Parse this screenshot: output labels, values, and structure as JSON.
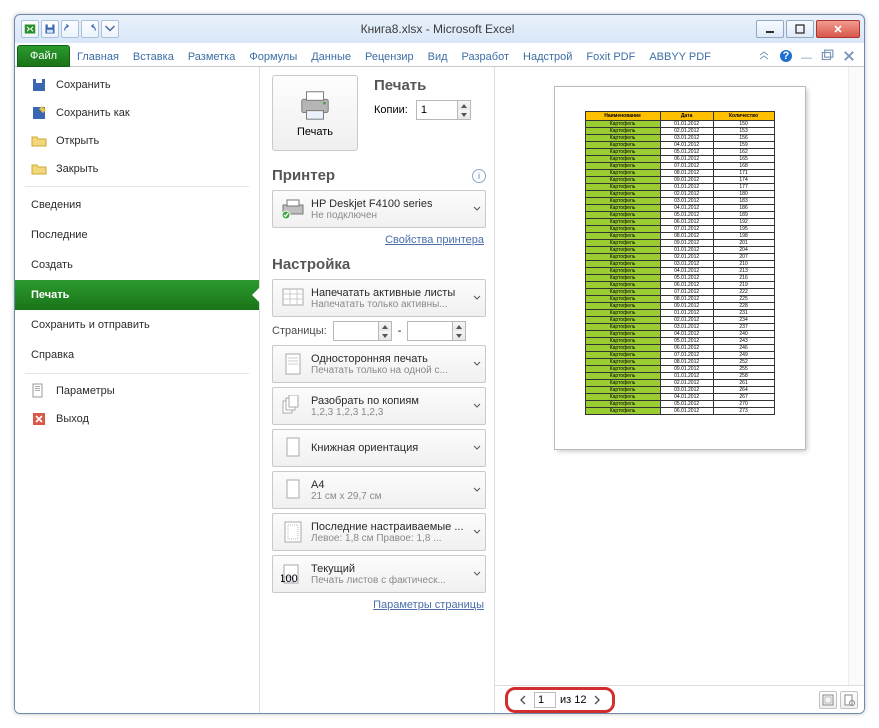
{
  "window": {
    "title": "Книга8.xlsx - Microsoft Excel"
  },
  "tabs": {
    "file": "Файл",
    "items": [
      "Главная",
      "Вставка",
      "Разметка",
      "Формулы",
      "Данные",
      "Рецензир",
      "Вид",
      "Разработ",
      "Надстрой",
      "Foxit PDF",
      "ABBYY PDF"
    ]
  },
  "sidebar": {
    "save": "Сохранить",
    "saveas": "Сохранить как",
    "open": "Открыть",
    "close": "Закрыть",
    "info": "Сведения",
    "recent": "Последние",
    "new": "Создать",
    "print": "Печать",
    "saveandsend": "Сохранить и отправить",
    "help": "Справка",
    "options": "Параметры",
    "exit": "Выход"
  },
  "print": {
    "header": "Печать",
    "button": "Печать",
    "copies_label": "Копии:",
    "copies_value": "1"
  },
  "printer": {
    "header": "Принтер",
    "name": "HP Deskjet F4100 series",
    "status": "Не подключен",
    "props": "Свойства принтера"
  },
  "settings": {
    "header": "Настройка",
    "what_title": "Напечатать активные листы",
    "what_sub": "Напечатать только активны...",
    "pages_label": "Страницы:",
    "pages_dash": "-",
    "side_title": "Односторонняя печать",
    "side_sub": "Печатать только на одной с...",
    "collate_title": "Разобрать по копиям",
    "collate_sub": "1,2,3   1,2,3   1,2,3",
    "orient_title": "Книжная ориентация",
    "size_title": "A4",
    "size_sub": "21 см x 29,7 см",
    "margins_title": "Последние настраиваемые ...",
    "margins_sub": "Левое: 1,8 см   Правое: 1,8 ...",
    "scale_title": "Текущий",
    "scale_sub": "Печать листов с фактическ...",
    "page_setup": "Параметры страницы"
  },
  "preview": {
    "page_value": "1",
    "page_total_label": "из 12",
    "headers": [
      "Наименование",
      "Дата",
      "Количество"
    ]
  }
}
